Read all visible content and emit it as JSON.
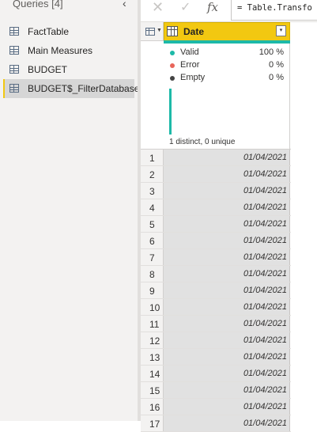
{
  "queries_pane": {
    "header": "Queries [4]",
    "collapse_glyph": "‹",
    "items": [
      {
        "label": "FactTable",
        "icon": "table-icon"
      },
      {
        "label": "Main Measures",
        "icon": "table-icon"
      },
      {
        "label": "BUDGET",
        "icon": "table-icon"
      },
      {
        "label": "BUDGET$_FilterDatabase",
        "icon": "table-icon",
        "selected": true
      }
    ]
  },
  "formula_bar": {
    "cancel_glyph": "✕",
    "commit_glyph": "✓",
    "fx_label": "fx",
    "formula": "= Table.Transfo"
  },
  "column": {
    "name": "Date",
    "dropdown_glyph": "▾"
  },
  "quality": {
    "valid": {
      "label": "Valid",
      "value": "100 %",
      "color": "#1db9a8"
    },
    "error": {
      "label": "Error",
      "value": "0 %",
      "color": "#e8655a"
    },
    "empty": {
      "label": "Empty",
      "value": "0 %",
      "color": "#444444"
    },
    "distribution": "1 distinct, 0 unique"
  },
  "rows": [
    {
      "n": "1",
      "date": "01/04/2021"
    },
    {
      "n": "2",
      "date": "01/04/2021"
    },
    {
      "n": "3",
      "date": "01/04/2021"
    },
    {
      "n": "4",
      "date": "01/04/2021"
    },
    {
      "n": "5",
      "date": "01/04/2021"
    },
    {
      "n": "6",
      "date": "01/04/2021"
    },
    {
      "n": "7",
      "date": "01/04/2021"
    },
    {
      "n": "8",
      "date": "01/04/2021"
    },
    {
      "n": "9",
      "date": "01/04/2021"
    },
    {
      "n": "10",
      "date": "01/04/2021"
    },
    {
      "n": "11",
      "date": "01/04/2021"
    },
    {
      "n": "12",
      "date": "01/04/2021"
    },
    {
      "n": "13",
      "date": "01/04/2021"
    },
    {
      "n": "14",
      "date": "01/04/2021"
    },
    {
      "n": "15",
      "date": "01/04/2021"
    },
    {
      "n": "16",
      "date": "01/04/2021"
    },
    {
      "n": "17",
      "date": "01/04/2021"
    }
  ],
  "colors": {
    "accent": "#f2c811",
    "valid_teal": "#1db9a8"
  }
}
